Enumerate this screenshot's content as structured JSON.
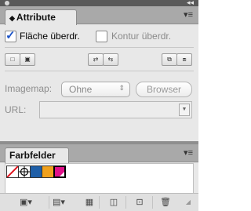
{
  "attribute_panel": {
    "tab_label": "Attribute",
    "fill_checkbox_label": "Fläche überdr.",
    "fill_checked": true,
    "stroke_checkbox_label": "Kontur überdr.",
    "stroke_checked": false,
    "imagemap_label": "Imagemap:",
    "imagemap_value": "Ohne",
    "browser_button": "Browser",
    "url_label": "URL:"
  },
  "swatches_panel": {
    "tab_label": "Farbfelder",
    "swatches": [
      "none",
      "registration",
      "#1f5fa8",
      "#f0a11d",
      "#e0128a"
    ]
  },
  "colors": {
    "accent_check": "#1e55c8",
    "swatch_blue": "#1f5fa8",
    "swatch_orange": "#f0a11d",
    "swatch_magenta": "#e0128a"
  }
}
